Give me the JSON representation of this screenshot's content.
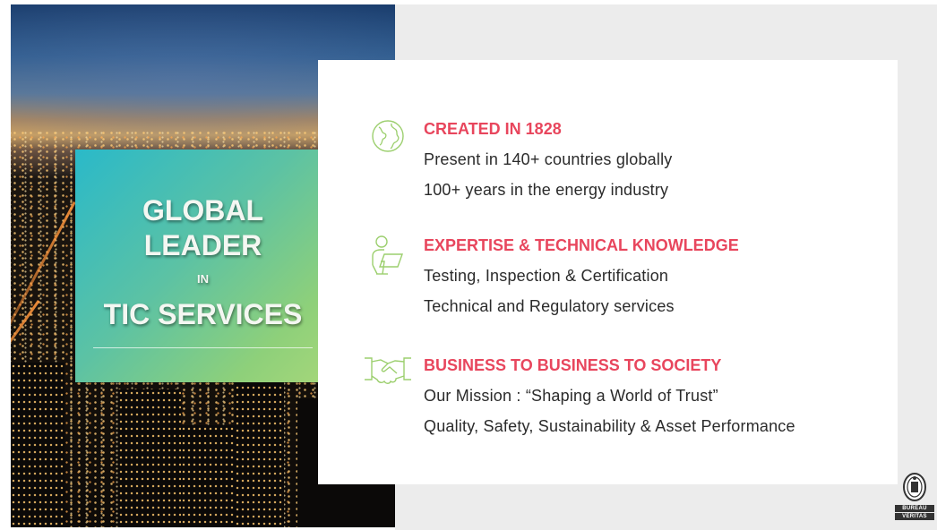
{
  "title_box": {
    "line1": "GLOBAL",
    "line2": "LEADER",
    "line3": "IN",
    "line4": "TIC SERVICES"
  },
  "sections": [
    {
      "icon": "globe-icon",
      "title": "CREATED IN 1828",
      "lines": [
        "Present in 140+ countries globally",
        "100+ years in the energy industry"
      ]
    },
    {
      "icon": "person-laptop-icon",
      "title": "EXPERTISE & TECHNICAL KNOWLEDGE",
      "lines": [
        "Testing, Inspection & Certification",
        "Technical and Regulatory services"
      ]
    },
    {
      "icon": "handshake-icon",
      "title": "BUSINESS TO BUSINESS TO SOCIETY",
      "lines": [
        "Our Mission : “Shaping a World of Trust”",
        "Quality, Safety, Sustainability & Asset Performance"
      ]
    }
  ],
  "logo": {
    "line1": "BUREAU",
    "line2": "VERITAS"
  },
  "colors": {
    "accent_title": "#e8465d",
    "icon_green": "#9ccf6e",
    "body_text": "#2b2b2b",
    "gradient_start": "#2ab9c9",
    "gradient_end": "#a6d77a",
    "panel_gray": "#ececec"
  }
}
